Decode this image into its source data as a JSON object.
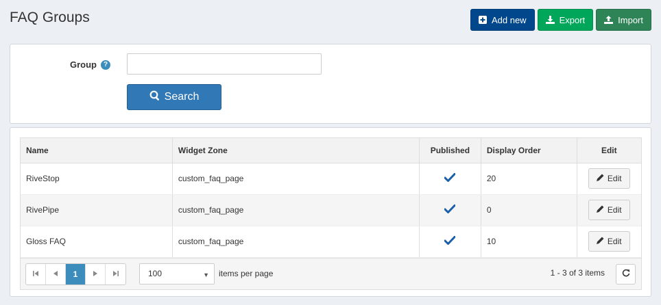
{
  "page": {
    "title": "FAQ Groups"
  },
  "toolbar": {
    "add_label": "Add new",
    "export_label": "Export",
    "import_label": "Import"
  },
  "search": {
    "group_label": "Group",
    "group_value": "",
    "button_label": "Search"
  },
  "table": {
    "headers": {
      "name": "Name",
      "widget_zone": "Widget Zone",
      "published": "Published",
      "display_order": "Display Order",
      "edit": "Edit"
    },
    "rows": [
      {
        "name": "RiveStop",
        "widget_zone": "custom_faq_page",
        "published": true,
        "display_order": "20",
        "edit_label": "Edit"
      },
      {
        "name": "RivePipe",
        "widget_zone": "custom_faq_page",
        "published": true,
        "display_order": "0",
        "edit_label": "Edit"
      },
      {
        "name": "Gloss FAQ",
        "widget_zone": "custom_faq_page",
        "published": true,
        "display_order": "10",
        "edit_label": "Edit"
      }
    ]
  },
  "pager": {
    "current_page": "1",
    "page_size": "100",
    "items_per_page_label": "items per page",
    "count_text": "1 - 3 of 3 items"
  },
  "colors": {
    "primary": "#00478c",
    "export": "#00a65a",
    "import": "#2e8456",
    "search": "#3078b6",
    "check": "#1a5fa8"
  }
}
